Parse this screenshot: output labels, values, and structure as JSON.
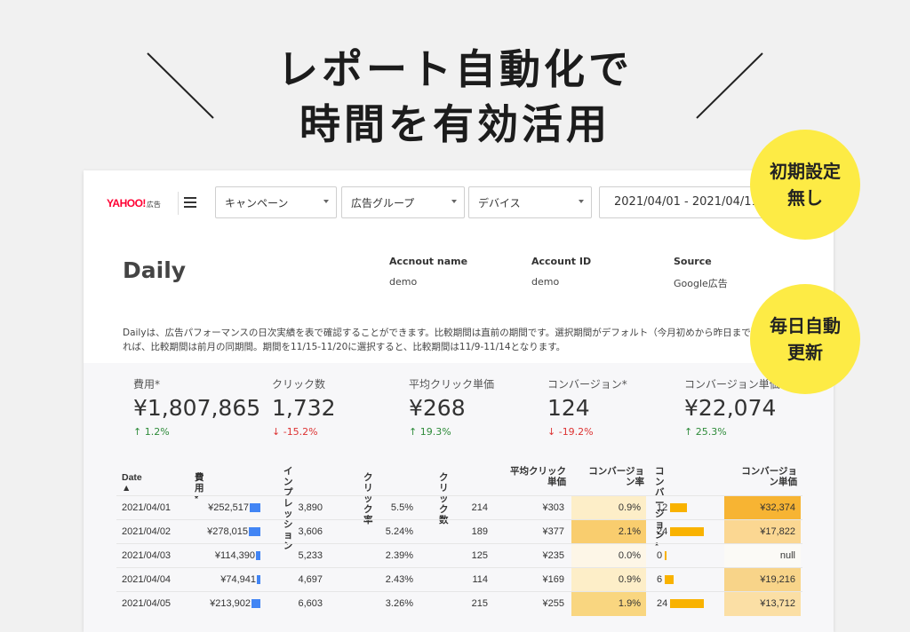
{
  "headline": {
    "line1": "レポート自動化で",
    "line2": "時間を有効活用"
  },
  "bubbles": {
    "b1_line1": "初期設定",
    "b1_line2": "無し",
    "b2_line1": "毎日自動",
    "b2_line2": "更新"
  },
  "app": {
    "logo_text": "YAHOO!",
    "logo_sub": "広告",
    "filters": {
      "campaign": "キャンペーン",
      "adgroup": "広告グループ",
      "device": "デバイス",
      "date_range": "2021/04/01 - 2021/04/11"
    },
    "page_title": "Daily",
    "meta": {
      "account_name_label": "Accnout name",
      "account_name": "demo",
      "account_id_label": "Account ID",
      "account_id": "demo",
      "source_label": "Source",
      "source": "Google広告"
    },
    "description": "Dailyは、広告パフォーマンスの日次実績を表で確認することができます。比較期間は直前の期間です。選択期間がデフォルト（今月初めから昨日まで）のままであれば、比較期間は前月の同期間。期間を11/15-11/20に選択すると、比較期間は11/9-11/14となります。",
    "kpis": [
      {
        "label": "費用*",
        "value": "¥1,807,865",
        "change": "1.2%",
        "dir": "up"
      },
      {
        "label": "クリック数",
        "value": "1,732",
        "change": "-15.2%",
        "dir": "down"
      },
      {
        "label": "平均クリック単価",
        "value": "¥268",
        "change": "19.3%",
        "dir": "up"
      },
      {
        "label": "コンバージョン*",
        "value": "124",
        "change": "-19.2%",
        "dir": "down"
      },
      {
        "label": "コンバージョン単価",
        "value": "¥22,074",
        "change": "25.3%",
        "dir": "up"
      }
    ],
    "table": {
      "headers": {
        "date": "Date ▲",
        "cost": "費用*",
        "imp_1": "インプレ",
        "imp_2": "ッション",
        "ctr": "クリック率",
        "clicks": "クリック数",
        "cpc_1": "平均クリック",
        "cpc_2": "単価",
        "cvr_1": "コンバージョ",
        "cvr_2": "ン率",
        "cv_1": "コンバージョ",
        "cv_2": "ン*",
        "cpa_1": "コンバージョ",
        "cpa_2": "ン単価"
      },
      "rows": [
        {
          "date": "2021/04/01",
          "cost": "¥252,517",
          "cost_frac": 0.91,
          "imp": "3,890",
          "ctr": "5.5%",
          "clicks": "214",
          "cpc": "¥303",
          "cvr": "0.9%",
          "cv": "12",
          "cv_frac": 0.5,
          "cpa": "¥32,374"
        },
        {
          "date": "2021/04/02",
          "cost": "¥278,015",
          "cost_frac": 1.0,
          "imp": "3,606",
          "ctr": "5.24%",
          "clicks": "189",
          "cpc": "¥377",
          "cvr": "2.1%",
          "cv": "24",
          "cv_frac": 1.0,
          "cpa": "¥17,822"
        },
        {
          "date": "2021/04/03",
          "cost": "¥114,390",
          "cost_frac": 0.41,
          "imp": "5,233",
          "ctr": "2.39%",
          "clicks": "125",
          "cpc": "¥235",
          "cvr": "0.0%",
          "cv": "0",
          "cv_frac": 0.0,
          "cpa": "null"
        },
        {
          "date": "2021/04/04",
          "cost": "¥74,941",
          "cost_frac": 0.27,
          "imp": "4,697",
          "ctr": "2.43%",
          "clicks": "114",
          "cpc": "¥169",
          "cvr": "0.9%",
          "cv": "6",
          "cv_frac": 0.25,
          "cpa": "¥19,216"
        },
        {
          "date": "2021/04/05",
          "cost": "¥213,902",
          "cost_frac": 0.77,
          "imp": "6,603",
          "ctr": "3.26%",
          "clicks": "215",
          "cpc": "¥255",
          "cvr": "1.9%",
          "cv": "24",
          "cv_frac": 1.0,
          "cpa": "¥13,712"
        }
      ]
    }
  }
}
